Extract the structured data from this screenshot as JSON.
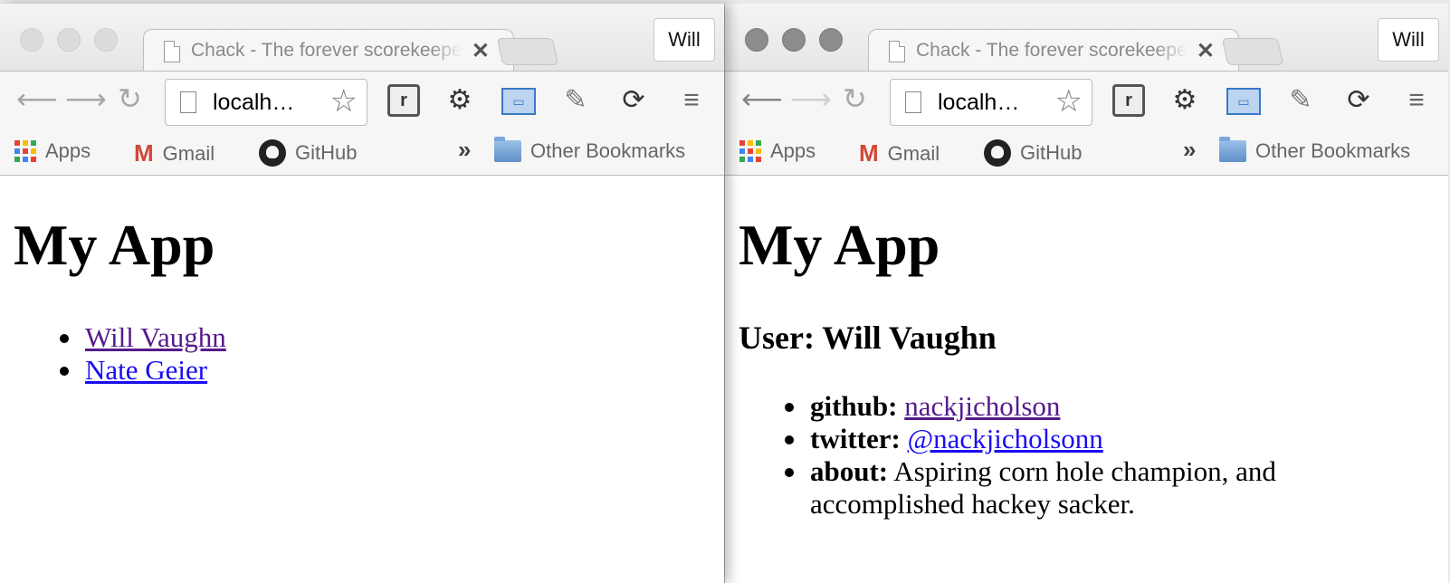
{
  "windows": [
    {
      "tab_title": "Chack - The forever scorekeeper",
      "profile_name": "Will",
      "address": "localh…",
      "bookmarks": {
        "apps": "Apps",
        "gmail": "Gmail",
        "github": "GitHub",
        "more": "»",
        "other": "Other Bookmarks"
      },
      "page": {
        "heading": "My App",
        "users": [
          "Will Vaughn",
          "Nate Geier"
        ]
      }
    },
    {
      "tab_title": "Chack - The forever scorekeeper",
      "profile_name": "Will",
      "address": "localh…",
      "bookmarks": {
        "apps": "Apps",
        "gmail": "Gmail",
        "github": "GitHub",
        "more": "»",
        "other": "Other Bookmarks"
      },
      "page": {
        "heading": "My App",
        "user_heading": "User: Will Vaughn",
        "details": [
          {
            "label": "github:",
            "value": "nackjicholson"
          },
          {
            "label": "twitter:",
            "value": "@nackjicholsonn"
          },
          {
            "label": "about:",
            "value": "Aspiring corn hole champion, and accomplished hackey sacker."
          }
        ]
      }
    }
  ],
  "icons": {
    "back": "arrow-left-icon",
    "forward": "arrow-right-icon",
    "reload": "reload-icon",
    "star": "star-icon",
    "settings": "gear-icon",
    "menu": "hamburger-menu-icon",
    "apps_colors": [
      "#e94235",
      "#fbbc04",
      "#34a853",
      "#4285f4",
      "#e94235",
      "#fbbc04",
      "#34a853",
      "#4285f4",
      "#e94235"
    ]
  }
}
